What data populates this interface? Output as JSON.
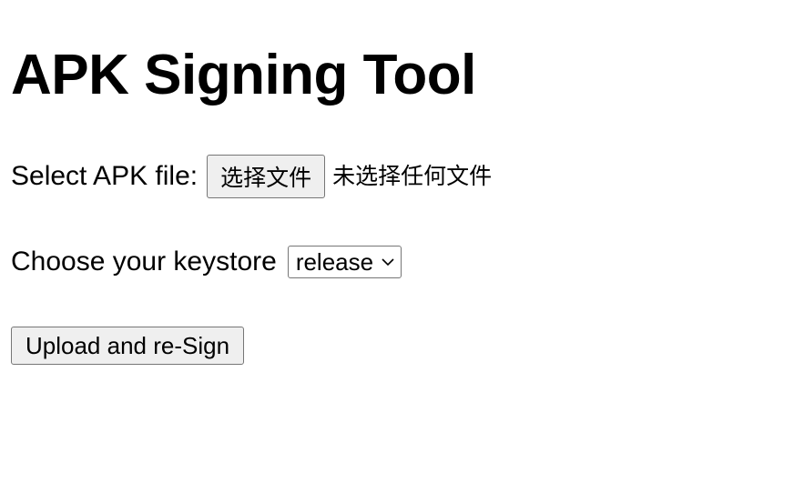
{
  "page": {
    "title": "APK Signing Tool"
  },
  "file_upload": {
    "label": "Select APK file:",
    "button_label": "选择文件",
    "status": "未选择任何文件"
  },
  "keystore": {
    "label": "Choose your keystore",
    "selected": "release",
    "icon": "chevron-down-icon"
  },
  "submit": {
    "label": "Upload and re-Sign"
  }
}
